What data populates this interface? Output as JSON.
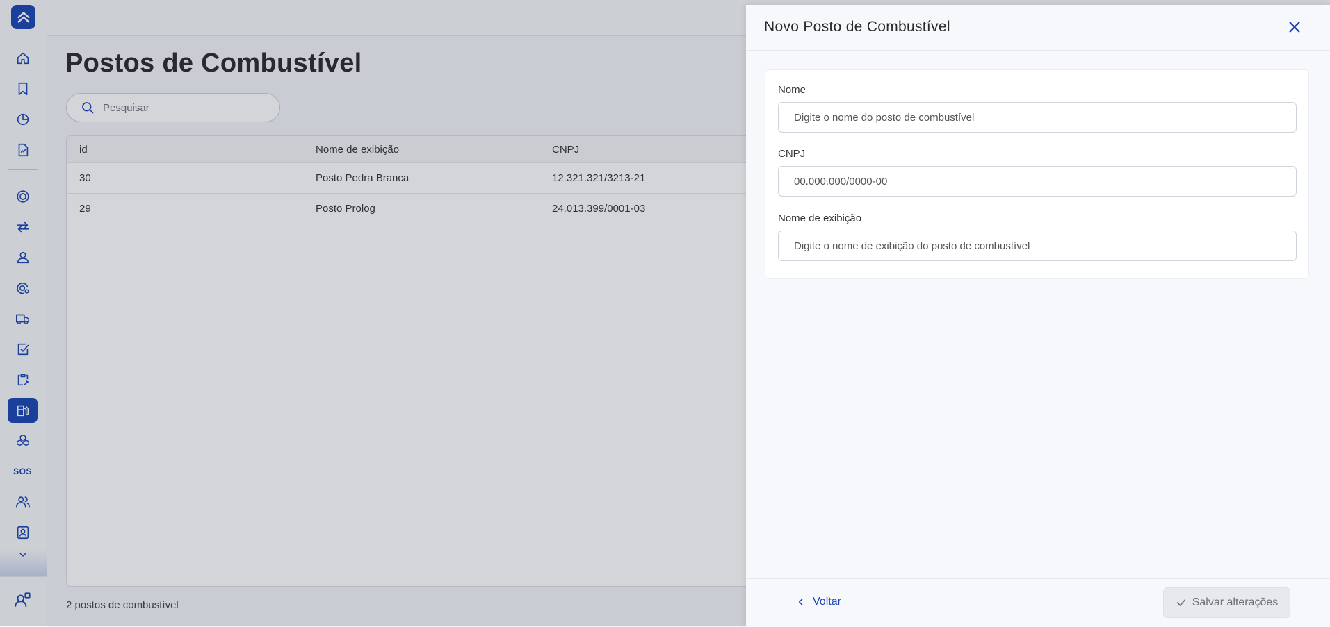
{
  "sidebar": {
    "items": [
      {
        "name": "home-icon"
      },
      {
        "name": "bookmark-icon"
      },
      {
        "name": "pie-chart-icon"
      },
      {
        "name": "report-document-icon"
      },
      {
        "name": "tire-icon"
      },
      {
        "name": "transfer-arrows-icon"
      },
      {
        "name": "driver-user-icon"
      },
      {
        "name": "tire-settings-icon"
      },
      {
        "name": "truck-icon"
      },
      {
        "name": "checklist-icon"
      },
      {
        "name": "clipboard-wrench-icon"
      },
      {
        "name": "fuel-pump-icon",
        "active": true
      },
      {
        "name": "cubes-icon"
      },
      {
        "name": "sos-icon",
        "label": "SOS"
      },
      {
        "name": "users-icon"
      },
      {
        "name": "id-badge-icon"
      }
    ],
    "footer_icon": "user-settings-icon"
  },
  "page": {
    "title": "Postos de Combustível",
    "search_placeholder": "Pesquisar",
    "table": {
      "headers": [
        "id",
        "Nome de exibição",
        "CNPJ"
      ],
      "rows": [
        [
          "30",
          "Posto Pedra Branca",
          "12.321.321/3213-21"
        ],
        [
          "29",
          "Posto Prolog",
          "24.013.399/0001-03"
        ]
      ]
    },
    "footer_count": "2 postos de combustível"
  },
  "drawer": {
    "title": "Novo Posto de Combustível",
    "fields": [
      {
        "label": "Nome",
        "placeholder": "Digite o nome do posto de combustível",
        "value": ""
      },
      {
        "label": "CNPJ",
        "placeholder": "00.000.000/0000-00",
        "value": ""
      },
      {
        "label": "Nome de exibição",
        "placeholder": "Digite o nome de exibição do posto de combustível",
        "value": ""
      }
    ],
    "back_label": "Voltar",
    "save_label": "Salvar alterações",
    "save_enabled": false
  },
  "colors": {
    "brand": "#1745b5",
    "overlay": "rgba(40,46,60,0.2)",
    "drawer_bg": "#f7f8fc"
  }
}
